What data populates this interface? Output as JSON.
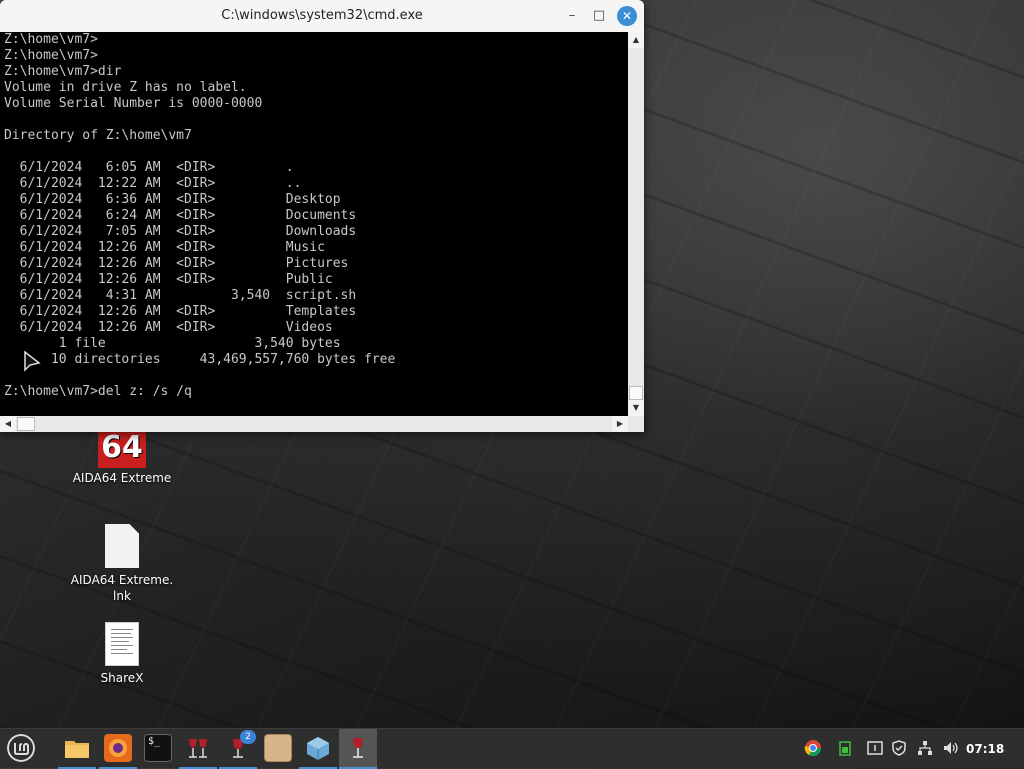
{
  "window": {
    "title": "C:\\windows\\system32\\cmd.exe",
    "min_symbol": "–",
    "max_symbol": "□",
    "close_symbol": "✕"
  },
  "console_lines": [
    "Z:\\home\\vm7>",
    "Z:\\home\\vm7>",
    "Z:\\home\\vm7>dir",
    "Volume in drive Z has no label.",
    "Volume Serial Number is 0000-0000",
    "",
    "Directory of Z:\\home\\vm7",
    "",
    "  6/1/2024   6:05 AM  <DIR>         .",
    "  6/1/2024  12:22 AM  <DIR>         ..",
    "  6/1/2024   6:36 AM  <DIR>         Desktop",
    "  6/1/2024   6:24 AM  <DIR>         Documents",
    "  6/1/2024   7:05 AM  <DIR>         Downloads",
    "  6/1/2024  12:26 AM  <DIR>         Music",
    "  6/1/2024  12:26 AM  <DIR>         Pictures",
    "  6/1/2024  12:26 AM  <DIR>         Public",
    "  6/1/2024   4:31 AM         3,540  script.sh",
    "  6/1/2024  12:26 AM  <DIR>         Templates",
    "  6/1/2024  12:26 AM  <DIR>         Videos",
    "       1 file                   3,540 bytes",
    "      10 directories     43,469,557,760 bytes free",
    "",
    "Z:\\home\\vm7>del z: /s /q"
  ],
  "desktop_icons": [
    {
      "label": "AIDA64 Extreme",
      "logo_text": "64",
      "icon": "aida64-icon"
    },
    {
      "label": "AIDA64 Extreme.\nlnk",
      "icon": "file-icon"
    },
    {
      "label": "ShareX",
      "icon": "document-icon"
    }
  ],
  "taskbar": {
    "items": [
      {
        "name": "mint-menu",
        "icon": "linux-mint-icon"
      },
      {
        "name": "files",
        "icon": "folder-icon"
      },
      {
        "name": "firefox",
        "icon": "firefox-icon"
      },
      {
        "name": "terminal",
        "icon": "terminal-icon",
        "glyph": "$_"
      },
      {
        "name": "wine-1",
        "icon": "wine-glasses-icon"
      },
      {
        "name": "wine-2",
        "icon": "wine-glass-icon",
        "badge": "2"
      },
      {
        "name": "archive",
        "icon": "archive-box-icon"
      },
      {
        "name": "network",
        "icon": "network-cube-icon"
      },
      {
        "name": "wine-active",
        "icon": "wine-glass-icon"
      }
    ],
    "tray": [
      "chrome-icon",
      "battery-icon",
      "update-icon",
      "shield-icon",
      "network-icon",
      "volume-icon"
    ],
    "clock": "07:18"
  },
  "colors": {
    "accent": "#4a90d9",
    "close_button": "#3b8ed6",
    "console_bg": "#000000",
    "console_fg": "#c8c8c8",
    "aida_red": "#c8201f"
  }
}
